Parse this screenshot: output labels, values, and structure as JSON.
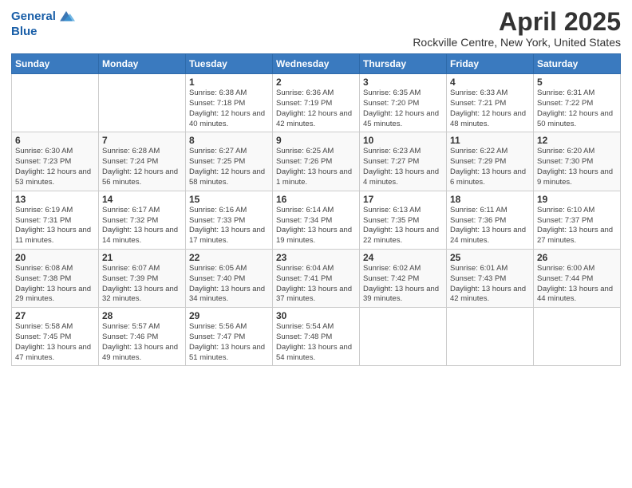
{
  "header": {
    "logo_line1": "General",
    "logo_line2": "Blue",
    "title": "April 2025",
    "subtitle": "Rockville Centre, New York, United States"
  },
  "days_of_week": [
    "Sunday",
    "Monday",
    "Tuesday",
    "Wednesday",
    "Thursday",
    "Friday",
    "Saturday"
  ],
  "weeks": [
    [
      {
        "day": "",
        "info": ""
      },
      {
        "day": "",
        "info": ""
      },
      {
        "day": "1",
        "info": "Sunrise: 6:38 AM\nSunset: 7:18 PM\nDaylight: 12 hours and 40 minutes."
      },
      {
        "day": "2",
        "info": "Sunrise: 6:36 AM\nSunset: 7:19 PM\nDaylight: 12 hours and 42 minutes."
      },
      {
        "day": "3",
        "info": "Sunrise: 6:35 AM\nSunset: 7:20 PM\nDaylight: 12 hours and 45 minutes."
      },
      {
        "day": "4",
        "info": "Sunrise: 6:33 AM\nSunset: 7:21 PM\nDaylight: 12 hours and 48 minutes."
      },
      {
        "day": "5",
        "info": "Sunrise: 6:31 AM\nSunset: 7:22 PM\nDaylight: 12 hours and 50 minutes."
      }
    ],
    [
      {
        "day": "6",
        "info": "Sunrise: 6:30 AM\nSunset: 7:23 PM\nDaylight: 12 hours and 53 minutes."
      },
      {
        "day": "7",
        "info": "Sunrise: 6:28 AM\nSunset: 7:24 PM\nDaylight: 12 hours and 56 minutes."
      },
      {
        "day": "8",
        "info": "Sunrise: 6:27 AM\nSunset: 7:25 PM\nDaylight: 12 hours and 58 minutes."
      },
      {
        "day": "9",
        "info": "Sunrise: 6:25 AM\nSunset: 7:26 PM\nDaylight: 13 hours and 1 minute."
      },
      {
        "day": "10",
        "info": "Sunrise: 6:23 AM\nSunset: 7:27 PM\nDaylight: 13 hours and 4 minutes."
      },
      {
        "day": "11",
        "info": "Sunrise: 6:22 AM\nSunset: 7:29 PM\nDaylight: 13 hours and 6 minutes."
      },
      {
        "day": "12",
        "info": "Sunrise: 6:20 AM\nSunset: 7:30 PM\nDaylight: 13 hours and 9 minutes."
      }
    ],
    [
      {
        "day": "13",
        "info": "Sunrise: 6:19 AM\nSunset: 7:31 PM\nDaylight: 13 hours and 11 minutes."
      },
      {
        "day": "14",
        "info": "Sunrise: 6:17 AM\nSunset: 7:32 PM\nDaylight: 13 hours and 14 minutes."
      },
      {
        "day": "15",
        "info": "Sunrise: 6:16 AM\nSunset: 7:33 PM\nDaylight: 13 hours and 17 minutes."
      },
      {
        "day": "16",
        "info": "Sunrise: 6:14 AM\nSunset: 7:34 PM\nDaylight: 13 hours and 19 minutes."
      },
      {
        "day": "17",
        "info": "Sunrise: 6:13 AM\nSunset: 7:35 PM\nDaylight: 13 hours and 22 minutes."
      },
      {
        "day": "18",
        "info": "Sunrise: 6:11 AM\nSunset: 7:36 PM\nDaylight: 13 hours and 24 minutes."
      },
      {
        "day": "19",
        "info": "Sunrise: 6:10 AM\nSunset: 7:37 PM\nDaylight: 13 hours and 27 minutes."
      }
    ],
    [
      {
        "day": "20",
        "info": "Sunrise: 6:08 AM\nSunset: 7:38 PM\nDaylight: 13 hours and 29 minutes."
      },
      {
        "day": "21",
        "info": "Sunrise: 6:07 AM\nSunset: 7:39 PM\nDaylight: 13 hours and 32 minutes."
      },
      {
        "day": "22",
        "info": "Sunrise: 6:05 AM\nSunset: 7:40 PM\nDaylight: 13 hours and 34 minutes."
      },
      {
        "day": "23",
        "info": "Sunrise: 6:04 AM\nSunset: 7:41 PM\nDaylight: 13 hours and 37 minutes."
      },
      {
        "day": "24",
        "info": "Sunrise: 6:02 AM\nSunset: 7:42 PM\nDaylight: 13 hours and 39 minutes."
      },
      {
        "day": "25",
        "info": "Sunrise: 6:01 AM\nSunset: 7:43 PM\nDaylight: 13 hours and 42 minutes."
      },
      {
        "day": "26",
        "info": "Sunrise: 6:00 AM\nSunset: 7:44 PM\nDaylight: 13 hours and 44 minutes."
      }
    ],
    [
      {
        "day": "27",
        "info": "Sunrise: 5:58 AM\nSunset: 7:45 PM\nDaylight: 13 hours and 47 minutes."
      },
      {
        "day": "28",
        "info": "Sunrise: 5:57 AM\nSunset: 7:46 PM\nDaylight: 13 hours and 49 minutes."
      },
      {
        "day": "29",
        "info": "Sunrise: 5:56 AM\nSunset: 7:47 PM\nDaylight: 13 hours and 51 minutes."
      },
      {
        "day": "30",
        "info": "Sunrise: 5:54 AM\nSunset: 7:48 PM\nDaylight: 13 hours and 54 minutes."
      },
      {
        "day": "",
        "info": ""
      },
      {
        "day": "",
        "info": ""
      },
      {
        "day": "",
        "info": ""
      }
    ]
  ]
}
